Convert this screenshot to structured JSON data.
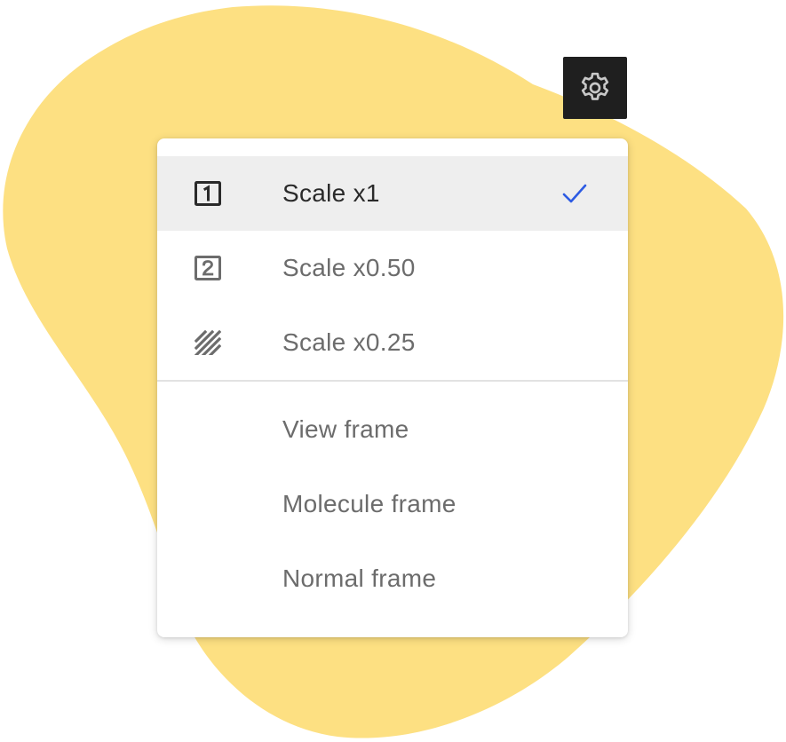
{
  "colors": {
    "blob": "#fde082",
    "gear_bg": "#1f1f1f",
    "gear_icon": "#c8c8c8",
    "check": "#2d5be3",
    "selected_bg": "#eeeeee",
    "label": "#6c6c6c",
    "label_selected": "#2a2a2a"
  },
  "settings_button": {
    "icon": "gear-icon"
  },
  "menu": {
    "scale_items": [
      {
        "label": "Scale x1",
        "icon": "scale-1-icon",
        "selected": true
      },
      {
        "label": "Scale x0.50",
        "icon": "scale-2-icon",
        "selected": false
      },
      {
        "label": "Scale x0.25",
        "icon": "hatched-icon",
        "selected": false
      }
    ],
    "frame_items": [
      {
        "label": "View frame"
      },
      {
        "label": "Molecule frame"
      },
      {
        "label": "Normal frame"
      }
    ],
    "check_icon": "checkmark-icon"
  }
}
